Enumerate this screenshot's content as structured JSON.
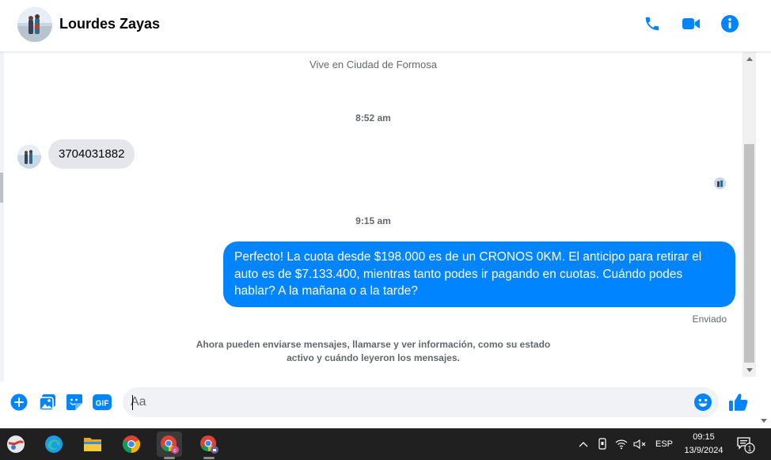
{
  "header": {
    "contact_name": "Lourdes Zayas",
    "icons": {
      "call": "phone-icon",
      "video": "video-camera-icon",
      "info": "info-icon"
    },
    "accent_color": "#0084ff"
  },
  "chat": {
    "location_info": "Vive en Ciudad de Formosa",
    "messages": [
      {
        "timestamp": "8:52 am",
        "direction": "incoming",
        "text": "3704031882"
      },
      {
        "timestamp": "9:15 am",
        "direction": "outgoing",
        "text": "Perfecto! La cuota desde $198.000 es de un CRONOS 0KM. El anticipo para retirar el auto es de $7.133.400, mientras tanto podes ir pagando en cuotas. Cuándo podes hablar? A la mañana o a la tarde?"
      }
    ],
    "sent_status": "Enviado",
    "notice_line1": "Ahora pueden enviarse mensajes, llamarse y ver información, como su estado",
    "notice_line2": "activo y cuándo leyeron los mensajes.",
    "incoming_bubble_color": "#e4e6eb",
    "outgoing_bubble_color": "#0084ff"
  },
  "composer": {
    "placeholder": "Aa",
    "value": "",
    "icons": [
      "plus-circle-icon",
      "photo-icon",
      "sticker-icon",
      "gif-icon",
      "emoji-icon",
      "thumbs-up-icon"
    ],
    "gif_label": "GIF"
  },
  "taskbar": {
    "apps": [
      "remote-desktop-icon",
      "edge-icon",
      "file-explorer-icon",
      "chrome-icon",
      "chrome-profile-c-icon",
      "chrome-profile-lock-icon"
    ],
    "tray_language": "ESP",
    "time": "09:15",
    "date": "13/9/2024",
    "notification_count": "1",
    "bg_color": "#202020"
  }
}
